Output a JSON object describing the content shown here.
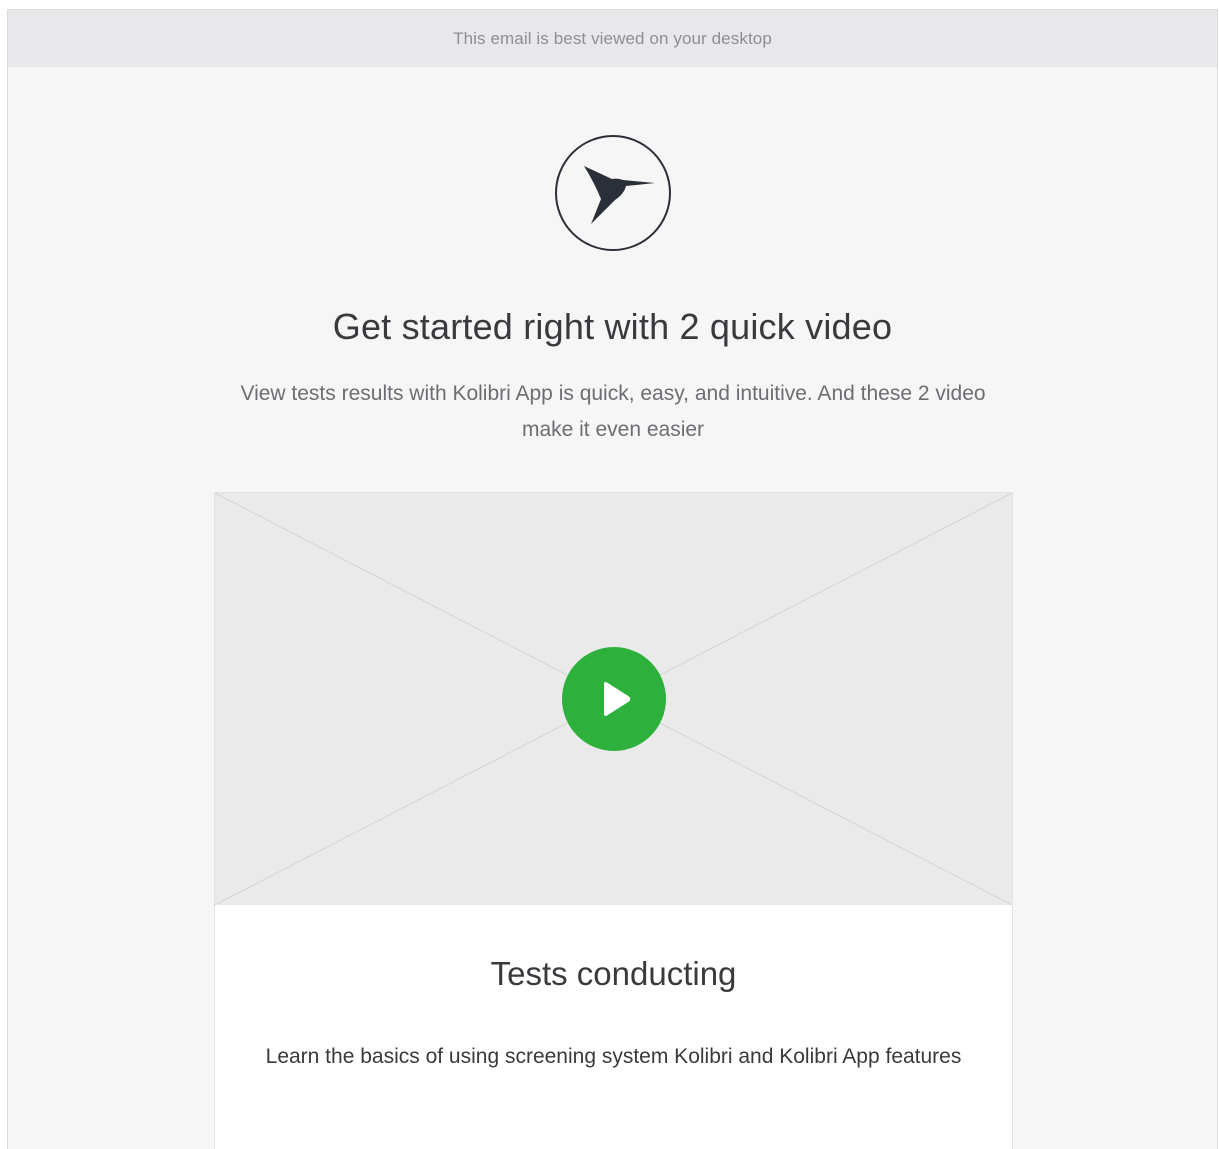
{
  "banner": {
    "text": "This email is best viewed on your desktop"
  },
  "logo": {
    "icon": "hummingbird-icon"
  },
  "hero": {
    "headline": "Get started right with 2 quick video",
    "intro": "View tests results with Kolibri App is quick, easy, and intuitive. And these 2 video make it even easier"
  },
  "video_card": {
    "thumbnail": "image-placeholder",
    "play_icon": "play-icon",
    "play_color": "#2db03c",
    "title": "Tests conducting",
    "description": "Learn the basics of using screening system Kolibri and Kolibri App features"
  },
  "colors": {
    "background": "#f6f6f7",
    "banner_bg": "#e8e8ea",
    "logo_ink": "#2b2f38",
    "accent": "#2db03c"
  }
}
